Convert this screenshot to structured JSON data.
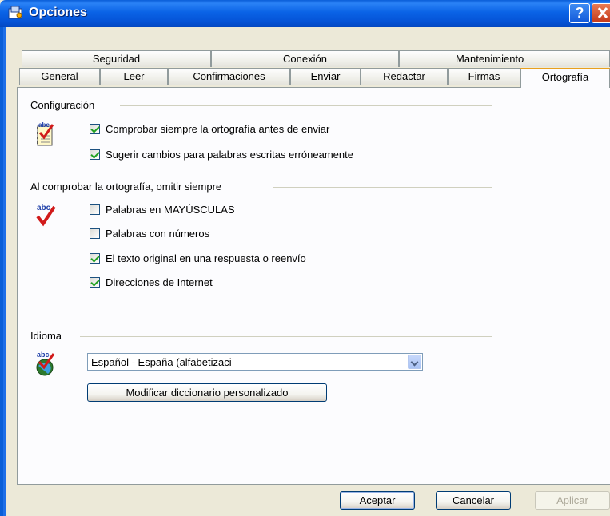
{
  "window": {
    "title": "Opciones"
  },
  "tabs_row1": [
    {
      "label": "Seguridad"
    },
    {
      "label": "Conexión"
    },
    {
      "label": "Mantenimiento"
    }
  ],
  "tabs_row2": [
    {
      "label": "General"
    },
    {
      "label": "Leer"
    },
    {
      "label": "Confirmaciones"
    },
    {
      "label": "Enviar"
    },
    {
      "label": "Redactar"
    },
    {
      "label": "Firmas"
    },
    {
      "label": "Ortografía",
      "active": true
    }
  ],
  "sections": {
    "config": {
      "label": "Configuración",
      "options": [
        {
          "label": "Comprobar siempre la ortografía antes de enviar",
          "checked": true
        },
        {
          "label": "Sugerir cambios para palabras escritas erróneamente",
          "checked": true
        }
      ]
    },
    "ignore": {
      "label": "Al comprobar la ortografía, omitir siempre",
      "options": [
        {
          "label": "Palabras en MAYÚSCULAS",
          "checked": false
        },
        {
          "label": "Palabras con números",
          "checked": false
        },
        {
          "label": "El texto original en una respuesta o reenvío",
          "checked": true
        },
        {
          "label": "Direcciones de Internet",
          "checked": true
        }
      ]
    },
    "language": {
      "label": "Idioma",
      "selected": "Español - España (alfabetizaci",
      "dictionary_button": "Modificar diccionario personalizado"
    }
  },
  "footer": {
    "ok": "Aceptar",
    "cancel": "Cancelar",
    "apply": "Aplicar"
  },
  "colors": {
    "titlebar": "#0a5ed8",
    "active_tab_accent": "#ffc83c",
    "check": "#21a121"
  }
}
